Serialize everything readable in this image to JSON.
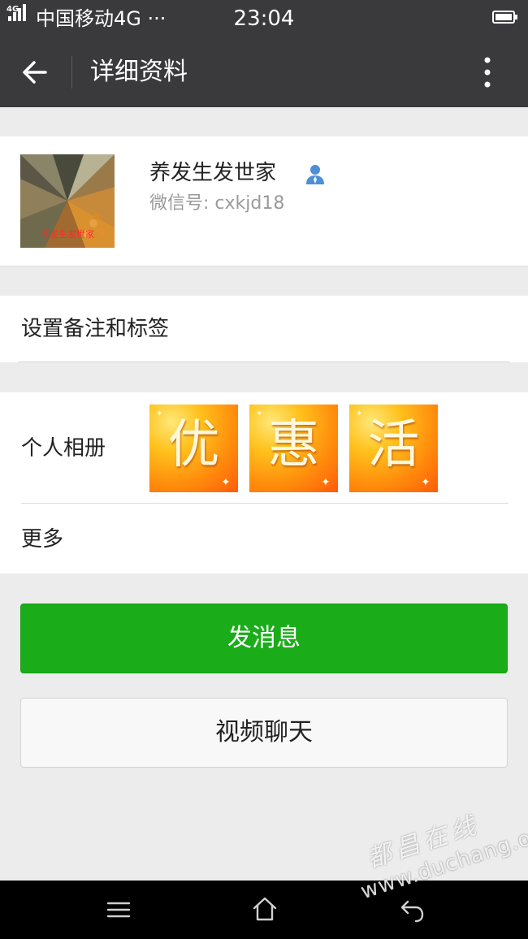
{
  "status_bar": {
    "network_badge": "4G",
    "carrier": "中国移动4G ···",
    "time": "23:04",
    "icons": [
      "signal-icon",
      "battery-icon"
    ]
  },
  "title_bar": {
    "title": "详细资料",
    "back_icon": "arrow-left-icon",
    "menu_icon": "more-vertical-icon"
  },
  "profile": {
    "nickname": "养发生发世家",
    "wechat_id": "微信号: cxkjd18",
    "badge_icon": "person-icon",
    "avatar_caption": "养发生发世家"
  },
  "remark": {
    "label": "设置备注和标签"
  },
  "album": {
    "label": "个人相册",
    "photos": [
      {
        "char": "优"
      },
      {
        "char": "惠"
      },
      {
        "char": "活"
      }
    ]
  },
  "more": {
    "label": "更多"
  },
  "buttons": {
    "send_message": "发消息",
    "video_chat": "视频聊天"
  },
  "colors": {
    "header_bg": "#3a3a3c",
    "primary_green": "#1aad19",
    "page_bg": "#ececec"
  },
  "watermark": {
    "top": "都昌在线",
    "bottom": "www.duchang.org"
  },
  "nav_bar": {
    "icons": [
      "menu-icon",
      "home-icon",
      "back-icon"
    ]
  }
}
